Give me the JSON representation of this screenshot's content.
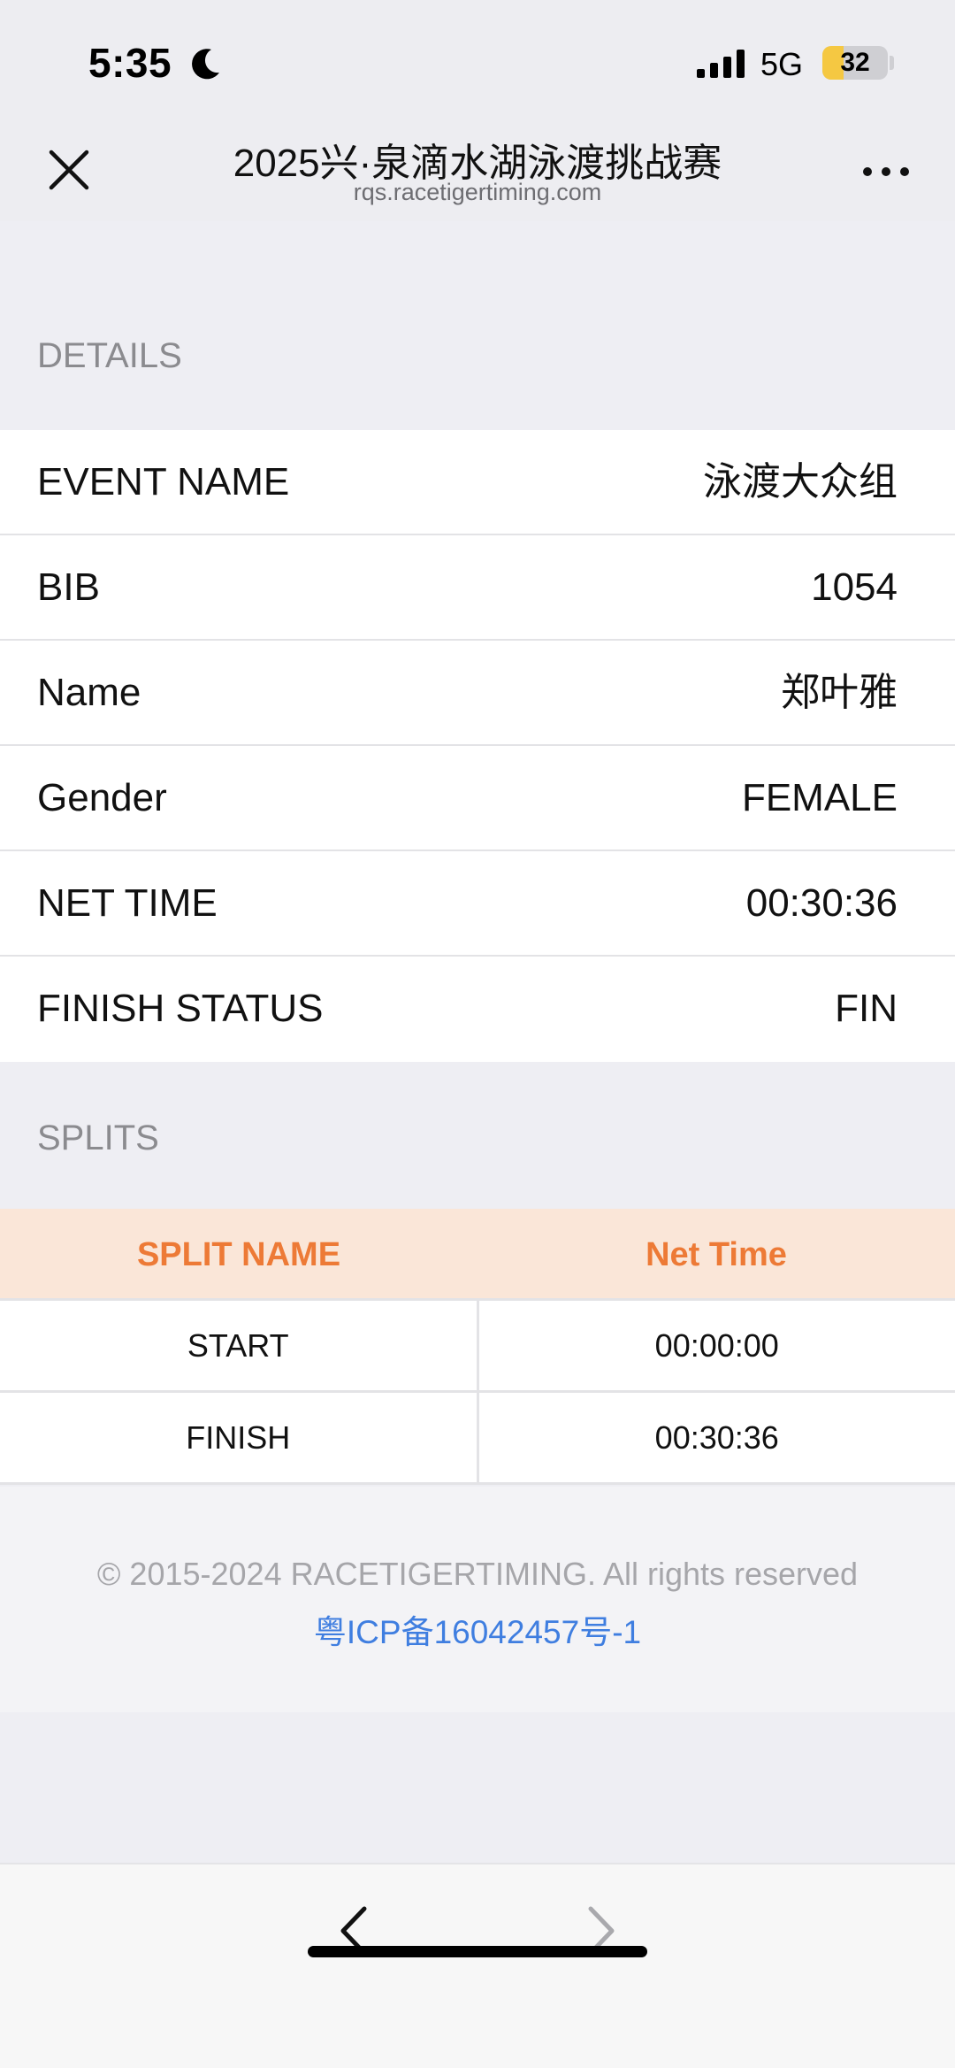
{
  "status_bar": {
    "time": "5:35",
    "network": "5G",
    "battery": 32,
    "icons": [
      "moon-icon",
      "signal-icon",
      "battery-icon"
    ]
  },
  "header": {
    "title": "2025兴·泉滴水湖泳渡挑战赛",
    "url": "rqs.racetigertiming.com",
    "icons": [
      "close-icon",
      "more-icon"
    ]
  },
  "details": {
    "section_title": "DETAILS",
    "rows": [
      {
        "label": "EVENT NAME",
        "value": "泳渡大众组"
      },
      {
        "label": "BIB",
        "value": "1054"
      },
      {
        "label": "Name",
        "value": "郑叶雅"
      },
      {
        "label": "Gender",
        "value": "FEMALE"
      },
      {
        "label": "NET TIME",
        "value": "00:30:36"
      },
      {
        "label": "FINISH STATUS",
        "value": "FIN"
      }
    ]
  },
  "splits": {
    "section_title": "SPLITS",
    "columns": [
      "SPLIT NAME",
      "Net Time"
    ],
    "rows": [
      {
        "name": "START",
        "time": "00:00:00"
      },
      {
        "name": "FINISH",
        "time": "00:30:36"
      }
    ]
  },
  "footer": {
    "copyright": "© 2015-2024 RACETIGERTIMING. All rights reserved",
    "icp": "粤ICP备16042457号-1"
  },
  "toolbar": {
    "icons": [
      "back-arrow-icon",
      "forward-arrow-icon"
    ]
  },
  "colors": {
    "accent": "#ed7a36",
    "split_header_bg": "#fae6d8",
    "link": "#3f7ee0",
    "battery_fill": "#f5c842"
  }
}
